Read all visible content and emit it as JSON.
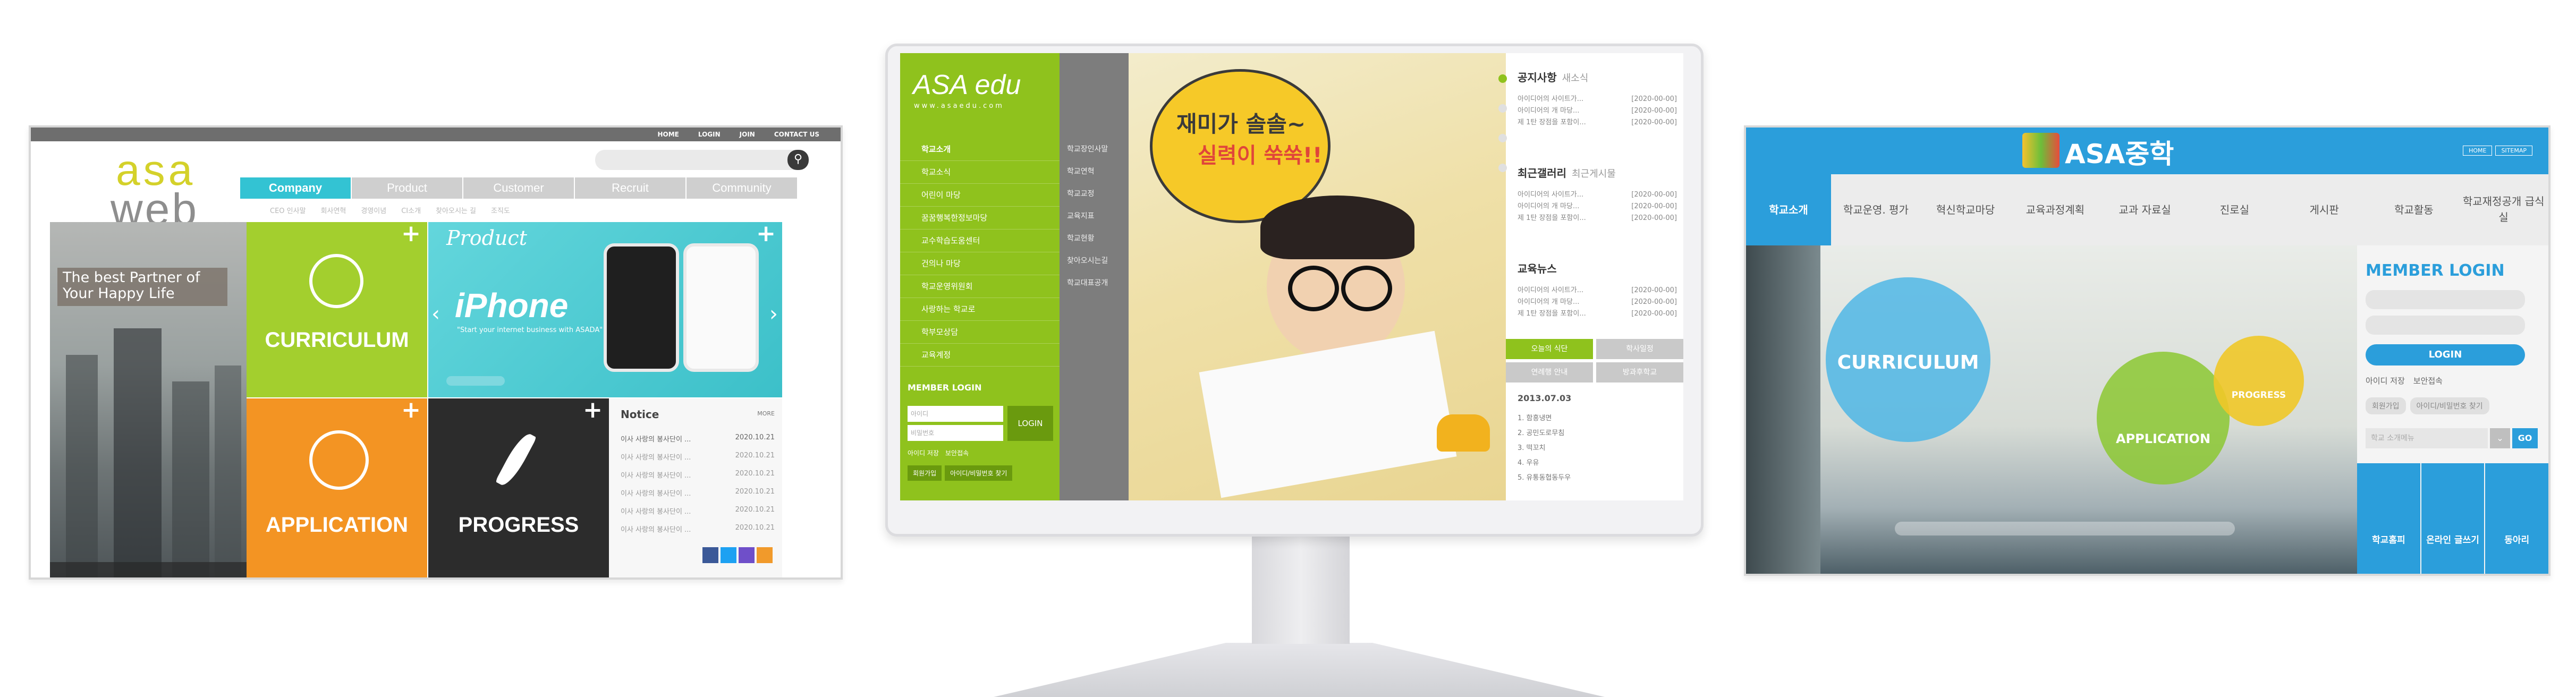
{
  "left_site": {
    "top_nav": [
      "HOME",
      "LOGIN",
      "JOIN",
      "CONTACT US"
    ],
    "logo_top": "asa",
    "logo_bottom": "web",
    "menu": [
      "Company",
      "Product",
      "Customer",
      "Recruit",
      "Community"
    ],
    "submenu": [
      "CEO 인사말",
      "회사연혁",
      "경영이념",
      "CI소개",
      "찾아오시는 길",
      "조직도"
    ],
    "hero_text": "The best Partner of Your Happy Life",
    "tile_curriculum": "CURRICULUM",
    "tile_product_title": "Product",
    "tile_product_name": "iPhone",
    "tile_product_slogan": "\"Start your internet business with ASADA\"",
    "tile_application": "APPLICATION",
    "tile_progress": "PROGRESS",
    "notice_title": "Notice",
    "notice_more": "MORE",
    "notice_items": [
      {
        "text": "이사 사랑의 봉사단이 ...",
        "date": "2020.10.21"
      },
      {
        "text": "이사 사랑의 봉사단이 ...",
        "date": "2020.10.21"
      },
      {
        "text": "이사 사랑의 봉사단이 ...",
        "date": "2020.10.21"
      },
      {
        "text": "이사 사랑의 봉사단이 ...",
        "date": "2020.10.21"
      },
      {
        "text": "이사 사랑의 봉사단이 ...",
        "date": "2020.10.21"
      },
      {
        "text": "이사 사랑의 봉사단이 ...",
        "date": "2020.10.21"
      }
    ]
  },
  "center_site": {
    "logo": "ASA edu",
    "url": "www.asaedu.com",
    "nav": [
      "학교소개",
      "학교소식",
      "어린이 마당",
      "꿈꿈행복한정보마당",
      "교수학습도움센터",
      "건의나 마당",
      "학교운영위원회",
      "사랑하는 학교로",
      "학부모상담",
      "교육계정"
    ],
    "subnav": [
      "학교장인사말",
      "학교연혁",
      "학교교정",
      "교육지표",
      "학교현황",
      "찾아오시는길",
      "학교대표공개"
    ],
    "login_title": "MEMBER LOGIN",
    "login_id": "아이디",
    "login_pw": "비밀번호",
    "login_btn": "LOGIN",
    "save_id": "아이디 저장",
    "secure": "보안접속",
    "join": "회원가입",
    "find": "아이디/비밀번호 찾기",
    "bubble_line1": "재미가 솔솔~",
    "bubble_line2": "실력이 쑥쑥!!",
    "notice_title": "공지사항",
    "notice_sub": "새소식",
    "gallery_title": "최근갤러리",
    "gallery_sub": "최근게시물",
    "news_title": "교육뉴스",
    "items": [
      {
        "text": "아이디어의 사이트가...",
        "date": "[2020-00-00]"
      },
      {
        "text": "아이디어의 개 마당...",
        "date": "[2020-00-00]"
      },
      {
        "text": "제 1탄 장점을 포함이...",
        "date": "[2020-00-00]"
      }
    ],
    "btn_month": "오늘의 식단",
    "btn_schedule": "학사일정",
    "btn_info": "연례행 안내",
    "btn_vote": "방과후학교",
    "date": "2013.07.03",
    "list": [
      "1. 함흥냉면",
      "2. 공민도로무침",
      "3. 떡꼬치",
      "4. 우유",
      "5. 유통동협동두우"
    ]
  },
  "right_site": {
    "logo": "ASA중학",
    "top_btns": [
      "HOME",
      "SITEMAP"
    ],
    "nav": [
      "학교소개",
      "학교운영. 평가",
      "혁신학교마당",
      "교육과정계획",
      "교과 자료실",
      "진로실",
      "게시판",
      "학교활동",
      "학교재정공개 급식실"
    ],
    "login_title": "MEMBER LOGIN",
    "login_btn": "LOGIN",
    "save_id": "아이디 저장",
    "secure": "보안접속",
    "join": "회원가입",
    "find": "아이디/비밀번호 찾기",
    "search_placeholder": "학교 소개메뉴",
    "go": "GO",
    "circle_curriculum": "CURRICULUM",
    "circle_application": "APPLICATION",
    "circle_progress": "PROGRESS",
    "quick": [
      "학교홈피",
      "온라인 글쓰기",
      "동아리"
    ]
  },
  "colors": {
    "green": "#8fc21d",
    "cyan": "#33c3d3",
    "orange": "#f39423",
    "blue": "#2b9edb",
    "yellow": "#d4d12a"
  }
}
